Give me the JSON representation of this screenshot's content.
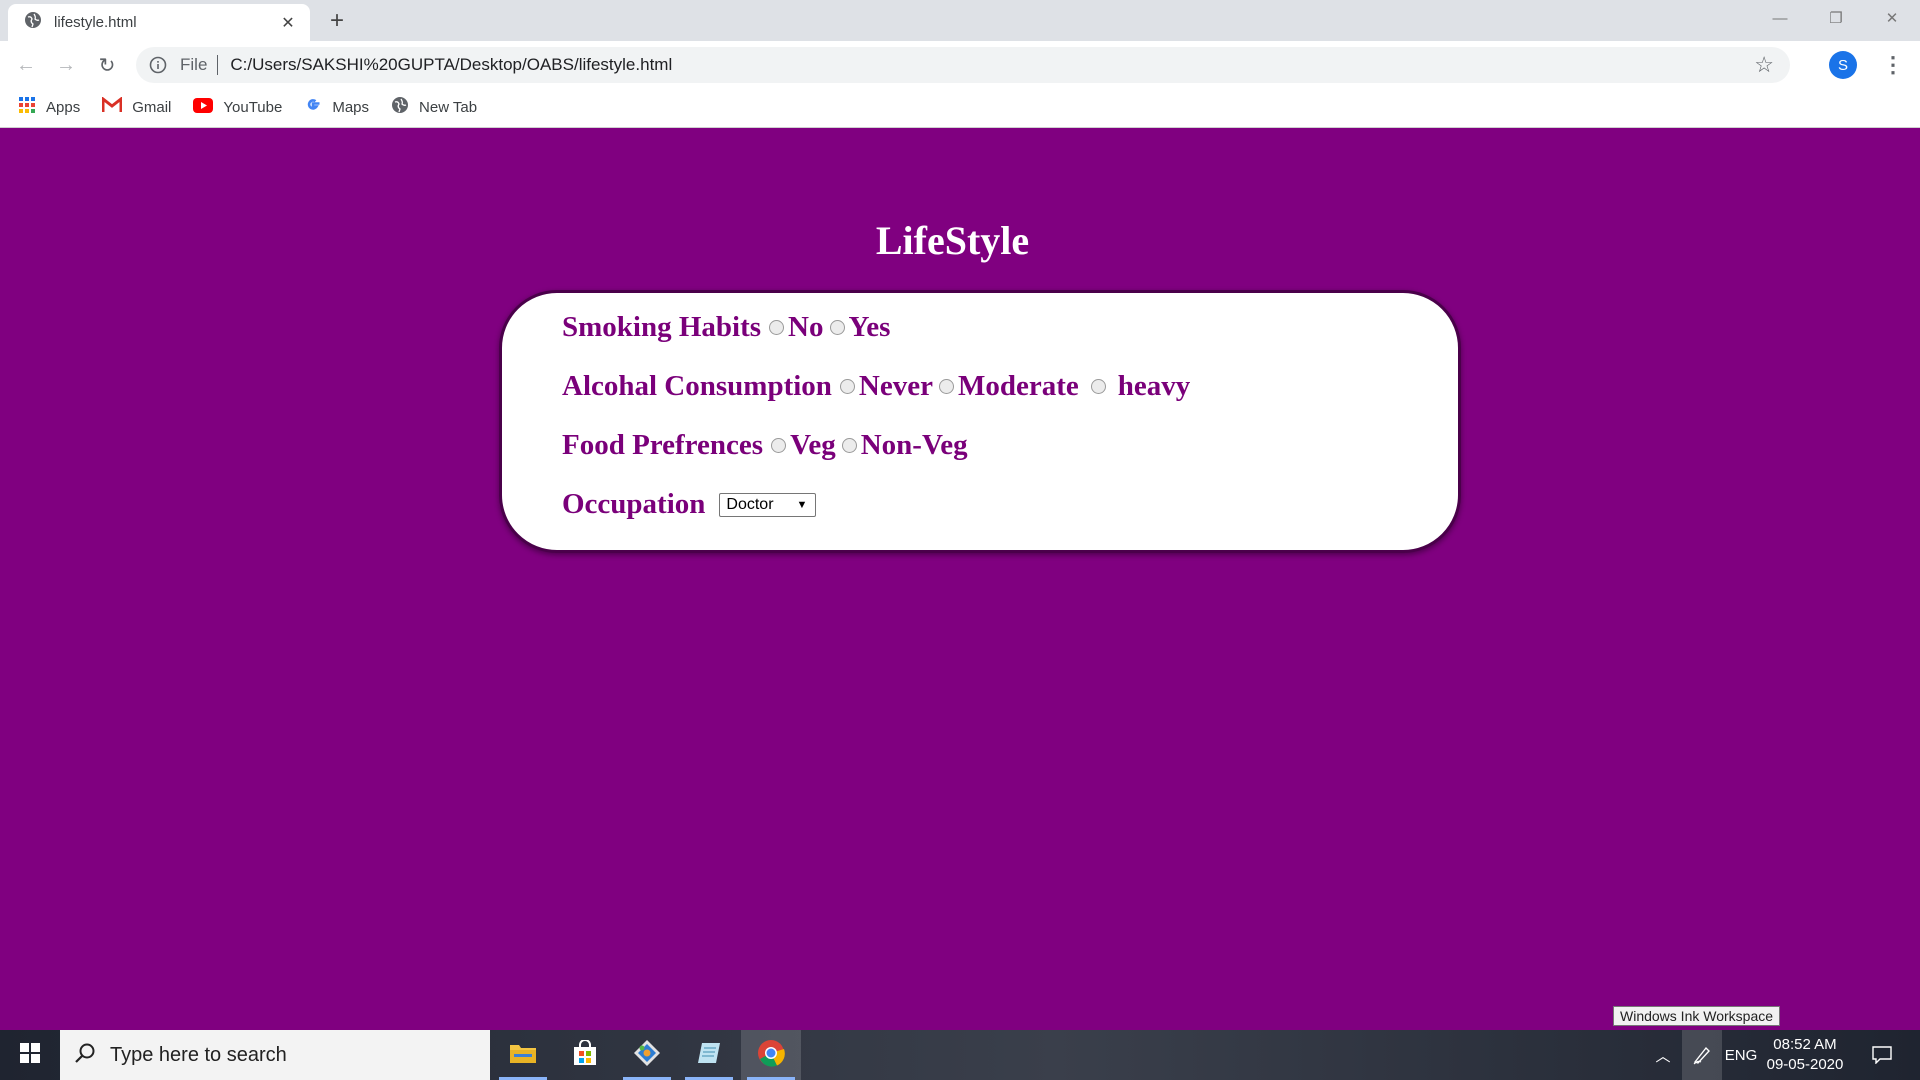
{
  "browser": {
    "tab_title": "lifestyle.html",
    "address_prefix": "File",
    "url": "C:/Users/SAKSHI%20GUPTA/Desktop/OABS/lifestyle.html",
    "profile_initial": "S",
    "bookmarks": [
      {
        "label": "Apps",
        "icon": "apps-grid-icon"
      },
      {
        "label": "Gmail",
        "icon": "gmail-icon"
      },
      {
        "label": "YouTube",
        "icon": "youtube-icon"
      },
      {
        "label": "Maps",
        "icon": "google-icon"
      },
      {
        "label": "New Tab",
        "icon": "globe-icon"
      }
    ]
  },
  "page": {
    "heading": "LifeStyle",
    "smoking": {
      "label": "Smoking Habits",
      "options": [
        "No",
        "Yes"
      ]
    },
    "alcohol": {
      "label": "Alcohal Consumption",
      "options": [
        "Never",
        "Moderate",
        "heavy"
      ]
    },
    "food": {
      "label": "Food Prefrences",
      "options": [
        "Veg",
        "Non-Veg"
      ]
    },
    "occupation": {
      "label": "Occupation",
      "selected": "Doctor"
    }
  },
  "taskbar": {
    "search_placeholder": "Type here to search",
    "language": "ENG",
    "time": "08:52 AM",
    "date": "09-05-2020",
    "tooltip": "Windows Ink Workspace"
  },
  "colors": {
    "page_background": "#800080",
    "label_text": "#7a007a",
    "card_background": "#ffffff"
  }
}
